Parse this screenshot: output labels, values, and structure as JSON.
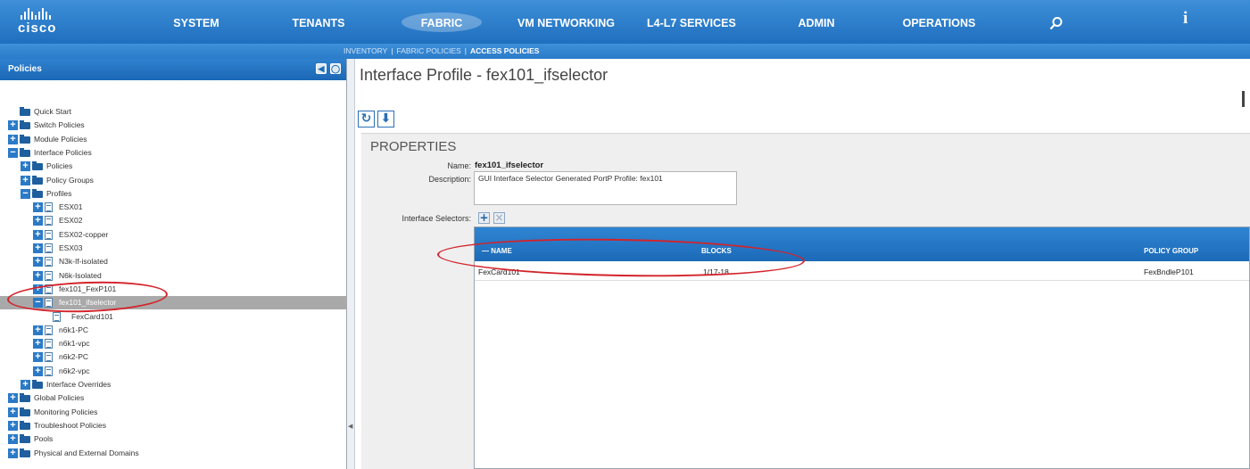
{
  "top_nav": {
    "logo_text": "cisco",
    "items": [
      "SYSTEM",
      "TENANTS",
      "FABRIC",
      "VM NETWORKING",
      "L4-L7 SERVICES",
      "ADMIN",
      "OPERATIONS"
    ],
    "active_index": 2,
    "search_icon": "search-icon",
    "info_label": "i"
  },
  "sub_nav": {
    "items": [
      "INVENTORY",
      "FABRIC POLICIES",
      "ACCESS POLICIES"
    ],
    "active_index": 2
  },
  "left_panel": {
    "title": "Policies",
    "tree": [
      {
        "label": "Quick Start",
        "type": "folder",
        "expand": "none"
      },
      {
        "label": "Switch Policies",
        "type": "folder",
        "expand": "plus"
      },
      {
        "label": "Module Policies",
        "type": "folder",
        "expand": "plus"
      },
      {
        "label": "Interface Policies",
        "type": "folder",
        "expand": "minus"
      },
      {
        "label": "Policies",
        "type": "folder",
        "expand": "plus"
      },
      {
        "label": "Policy Groups",
        "type": "folder",
        "expand": "plus"
      },
      {
        "label": "Profiles",
        "type": "folder",
        "expand": "minus"
      },
      {
        "label": "ESX01",
        "type": "doc",
        "expand": "plus"
      },
      {
        "label": "ESX02",
        "type": "doc",
        "expand": "plus"
      },
      {
        "label": "ESX02-copper",
        "type": "doc",
        "expand": "plus"
      },
      {
        "label": "ESX03",
        "type": "doc",
        "expand": "plus"
      },
      {
        "label": "N3k-If-isolated",
        "type": "doc",
        "expand": "plus"
      },
      {
        "label": "N6k-Isolated",
        "type": "doc",
        "expand": "plus"
      },
      {
        "label": "fex101_FexP101",
        "type": "doc",
        "expand": "plus"
      },
      {
        "label": "fex101_ifselector",
        "type": "doc",
        "expand": "minus",
        "selected": true
      },
      {
        "label": "FexCard101",
        "type": "doc",
        "expand": "none"
      },
      {
        "label": "n6k1-PC",
        "type": "doc",
        "expand": "plus"
      },
      {
        "label": "n6k1-vpc",
        "type": "doc",
        "expand": "plus"
      },
      {
        "label": "n6k2-PC",
        "type": "doc",
        "expand": "plus"
      },
      {
        "label": "n6k2-vpc",
        "type": "doc",
        "expand": "plus"
      },
      {
        "label": "Interface Overrides",
        "type": "folder",
        "expand": "plus"
      },
      {
        "label": "Global Policies",
        "type": "folder",
        "expand": "plus"
      },
      {
        "label": "Monitoring Policies",
        "type": "folder",
        "expand": "plus"
      },
      {
        "label": "Troubleshoot Policies",
        "type": "folder",
        "expand": "plus"
      },
      {
        "label": "Pools",
        "type": "folder",
        "expand": "plus"
      },
      {
        "label": "Physical and External Domains",
        "type": "folder",
        "expand": "plus"
      }
    ]
  },
  "main": {
    "title": "Interface Profile - fex101_ifselector",
    "properties_title": "PROPERTIES",
    "name_label": "Name:",
    "name_value": "fex101_ifselector",
    "description_label": "Description:",
    "description_value": "GUI Interface Selector Generated PortP Profile: fex101",
    "selectors_label": "Interface Selectors:",
    "columns": [
      "NAME",
      "BLOCKS",
      "POLICY GROUP"
    ],
    "rows": [
      {
        "name": "FexCard101",
        "blocks": "1/17-18",
        "policy_group": "FexBndleP101"
      }
    ]
  },
  "colors": {
    "nav_blue": "#2a7bc9",
    "annotation_red": "#d3232b",
    "selected_row": "#a9a9a9"
  }
}
